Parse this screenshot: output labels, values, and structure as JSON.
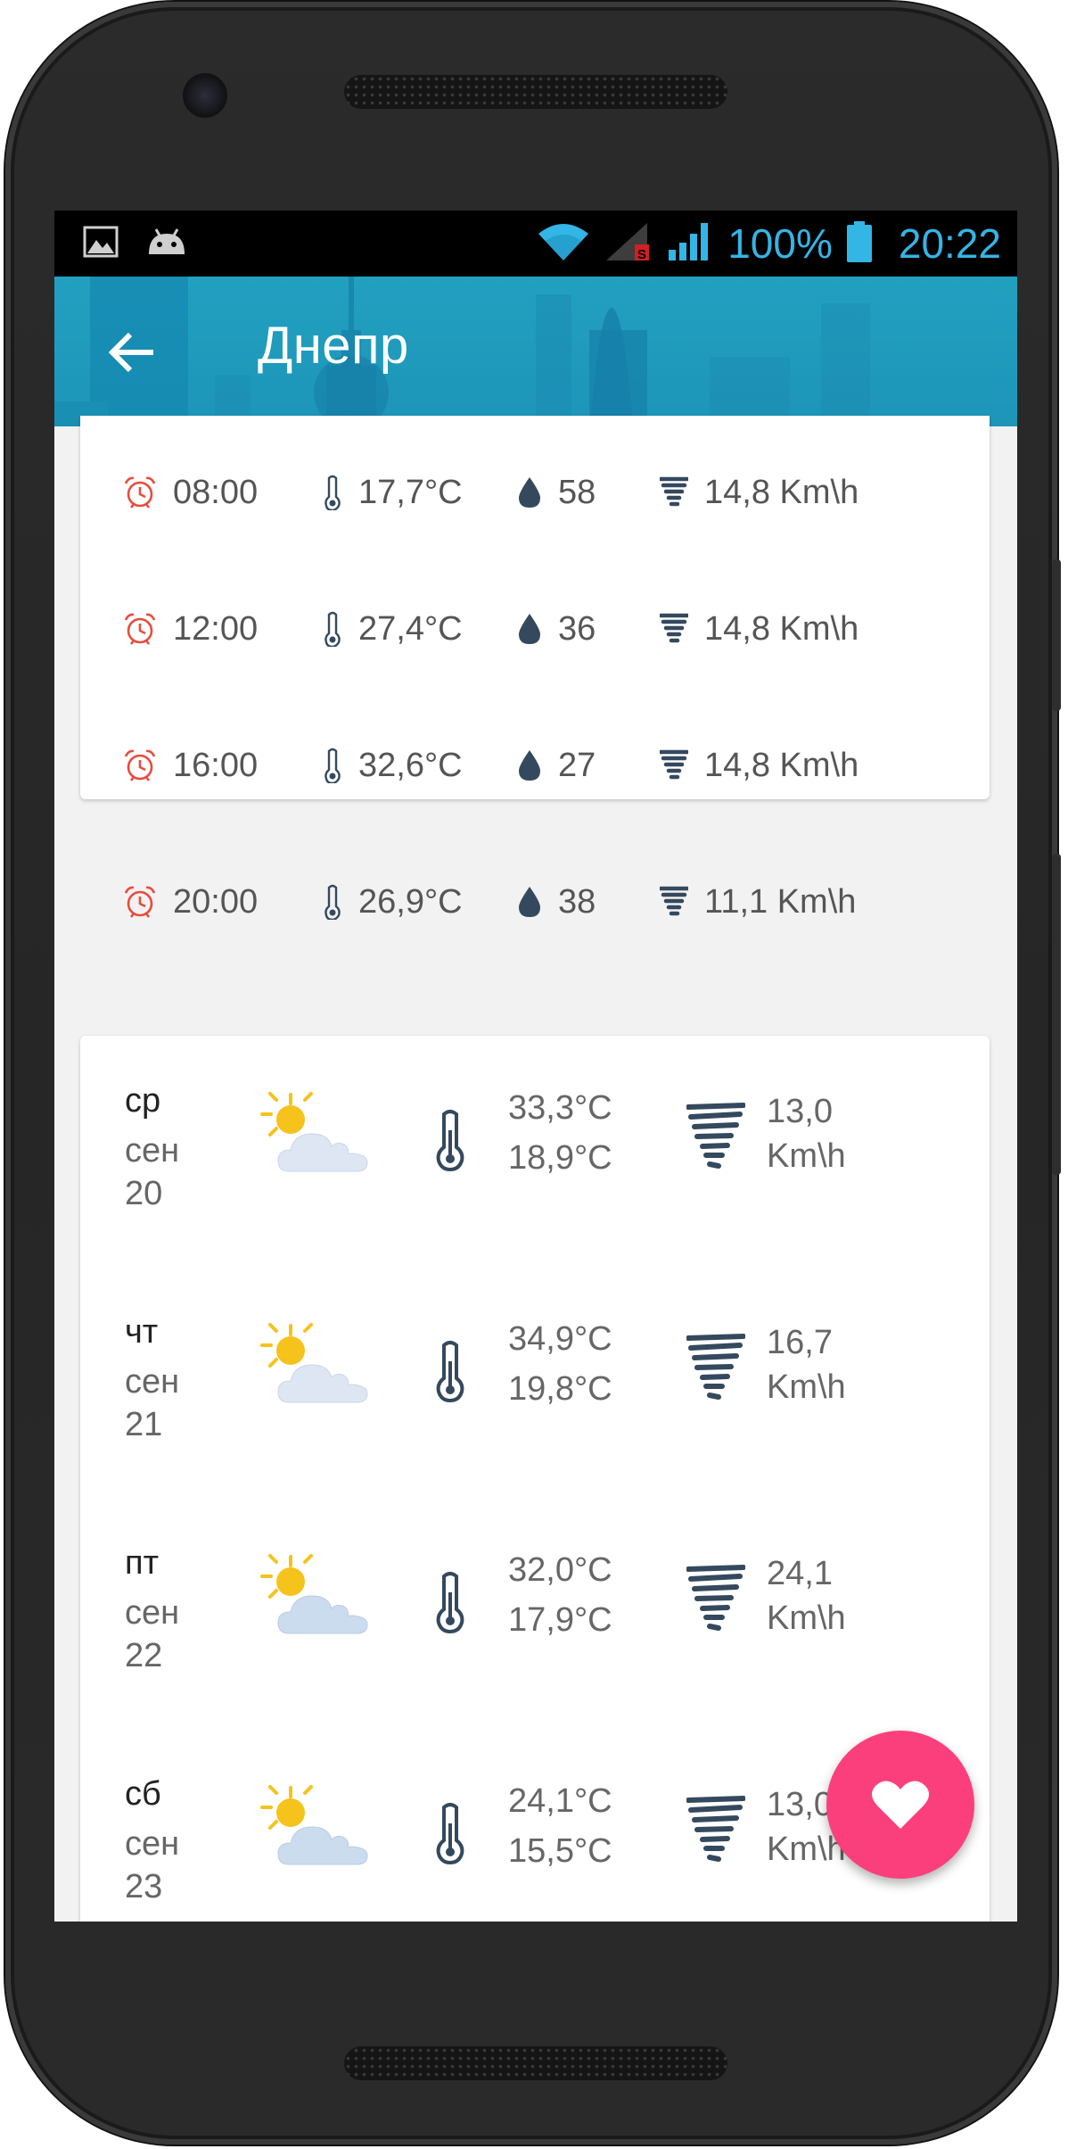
{
  "status_bar": {
    "battery": "100%",
    "time": "20:22",
    "sim_badge": "S",
    "accent_color": "#33b5e5",
    "icons": [
      "image-icon",
      "android-icon",
      "wifi-icon",
      "signal-sim1-icon",
      "signal-sim2-icon",
      "battery-icon"
    ]
  },
  "app_bar": {
    "title": "Днепр",
    "background_color": "#1d95b8"
  },
  "hourly": [
    {
      "time": "08:00",
      "temp": "17,7°C",
      "humidity": "58",
      "wind": "14,8 Km\\h"
    },
    {
      "time": "12:00",
      "temp": "27,4°C",
      "humidity": "36",
      "wind": "14,8 Km\\h"
    },
    {
      "time": "16:00",
      "temp": "32,6°C",
      "humidity": "27",
      "wind": "14,8 Km\\h"
    },
    {
      "time": "20:00",
      "temp": "26,9°C",
      "humidity": "38",
      "wind": "11,1 Km\\h"
    }
  ],
  "daily": [
    {
      "day": "ср",
      "month": "сен",
      "date": "20",
      "temp_max": "33,3°C",
      "temp_min": "18,9°C",
      "wind": "13,0",
      "wind_unit": "Km\\h",
      "icon": "partly-cloudy-icon"
    },
    {
      "day": "чт",
      "month": "сен",
      "date": "21",
      "temp_max": "34,9°C",
      "temp_min": "19,8°C",
      "wind": "16,7",
      "wind_unit": "Km\\h",
      "icon": "partly-cloudy-icon"
    },
    {
      "day": "пт",
      "month": "сен",
      "date": "22",
      "temp_max": "32,0°C",
      "temp_min": "17,9°C",
      "wind": "24,1",
      "wind_unit": "Km\\h",
      "icon": "partly-cloudy-icon"
    },
    {
      "day": "сб",
      "month": "сен",
      "date": "23",
      "temp_max": "24,1°C",
      "temp_min": "15,5°C",
      "wind": "13,0",
      "wind_unit": "Km\\h",
      "icon": "partly-cloudy-icon"
    }
  ],
  "fab": {
    "icon": "heart-icon",
    "color": "#fb3f7d"
  },
  "colors": {
    "alarm": "#e84c3d",
    "icon_dark": "#34495e",
    "text": "#555555"
  }
}
